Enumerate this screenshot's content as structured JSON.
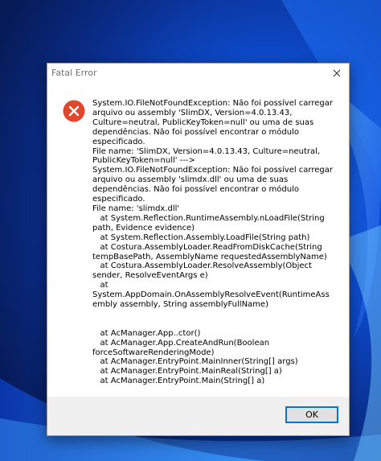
{
  "window": {
    "title": "Fatal Error",
    "close_icon": "close-icon"
  },
  "dialog": {
    "icon": "error-icon",
    "message": "System.IO.FileNotFoundException: Não foi possível carregar arquivo ou assembly 'SlimDX, Version=4.0.13.43, Culture=neutral, PublicKeyToken=null' ou uma de suas dependências. Não foi possível encontrar o módulo especificado.\nFile name: 'SlimDX, Version=4.0.13.43, Culture=neutral, PublicKeyToken=null' ---> System.IO.FileNotFoundException: Não foi possível carregar arquivo ou assembly 'slimdx.dll' ou uma de suas dependências. Não foi possível encontrar o módulo especificado.\nFile name: 'slimdx.dll'\n   at System.Reflection.RuntimeAssembly.nLoadFile(String path, Evidence evidence)\n   at System.Reflection.Assembly.LoadFile(String path)\n   at Costura.AssemblyLoader.ReadFromDiskCache(String tempBasePath, AssemblyName requestedAssemblyName)\n   at Costura.AssemblyLoader.ResolveAssembly(Object sender, ResolveEventArgs e)\n   at System.AppDomain.OnAssemblyResolveEvent(RuntimeAssembly assembly, String assemblyFullName)\n\n\n   at AcManager.App..ctor()\n   at AcManager.App.CreateAndRun(Boolean forceSoftwareRenderingMode)\n   at AcManager.EntryPoint.MainInner(String[] args)\n   at AcManager.EntryPoint.MainReal(String[] a)\n   at AcManager.EntryPoint.Main(String[] a)"
  },
  "buttons": {
    "ok_label": "OK"
  },
  "colors": {
    "error_red": "#e0472c",
    "accent": "#0078d4"
  }
}
